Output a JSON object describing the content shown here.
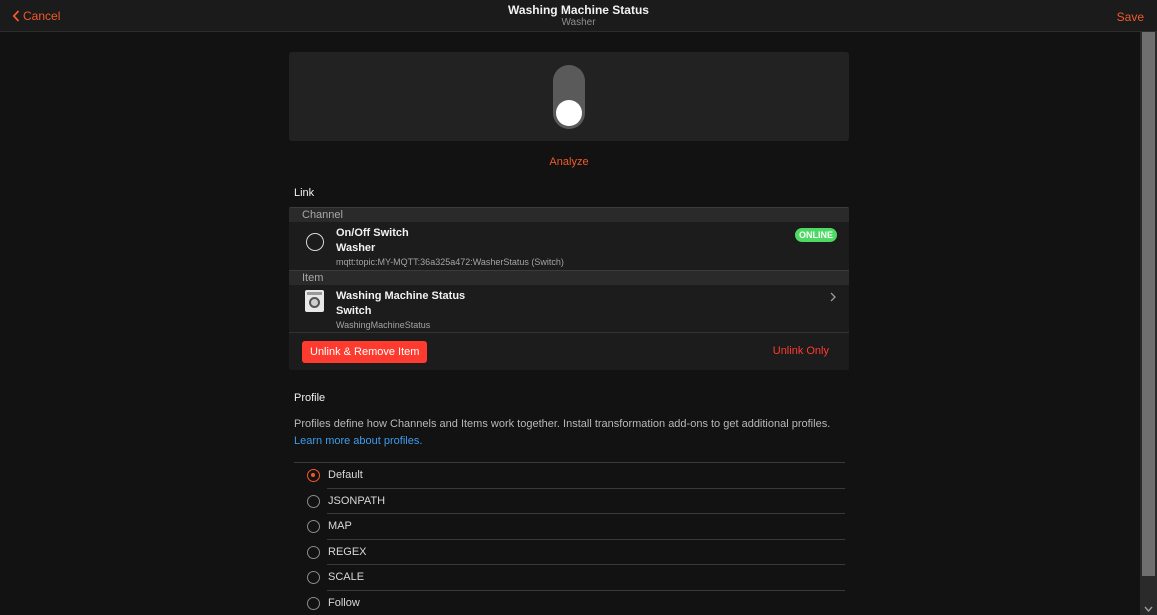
{
  "nav": {
    "back_label": "Cancel",
    "title": "Washing Machine Status",
    "subtitle": "Washer",
    "save_label": "Save"
  },
  "preview": {
    "toggle_state": "off",
    "analyze_label": "Analyze"
  },
  "link": {
    "title": "Link",
    "channel_header": "Channel",
    "channel": {
      "label": "On/Off Switch",
      "thing": "Washer",
      "uid": "mqtt:topic:MY-MQTT:36a325a472:WasherStatus (Switch)",
      "status": "ONLINE"
    },
    "item_header": "Item",
    "item": {
      "label": "Washing Machine Status",
      "type": "Switch",
      "name": "WashingMachineStatus",
      "icon": "washer-icon"
    },
    "unlink_remove_label": "Unlink & Remove Item",
    "unlink_only_label": "Unlink Only"
  },
  "profile": {
    "title": "Profile",
    "description": "Profiles define how Channels and Items work together. Install transformation add-ons to get additional profiles.",
    "learn_more": "Learn more about profiles.",
    "options": [
      "Default",
      "JSONPATH",
      "MAP",
      "REGEX",
      "SCALE",
      "Follow"
    ],
    "selected": "Default"
  },
  "colors": {
    "accent": "#f1592a",
    "danger": "#ff3b30",
    "online": "#4cd964",
    "link": "#3d9bea",
    "background": "#121212"
  }
}
